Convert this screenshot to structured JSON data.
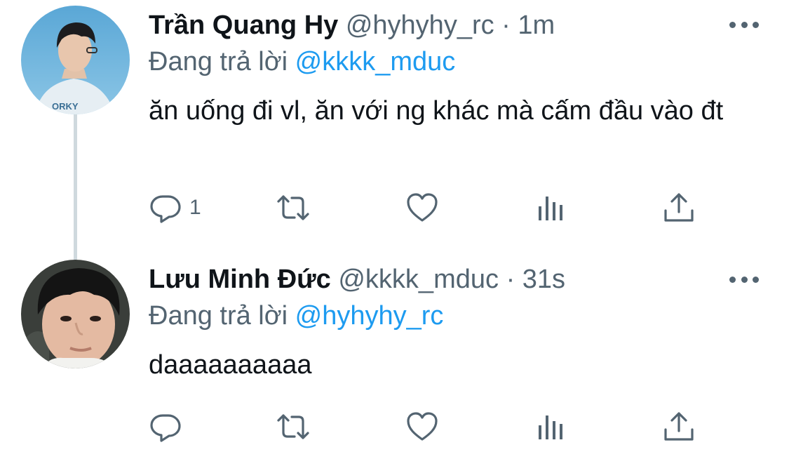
{
  "tweets": [
    {
      "name": "Trần Quang Hy",
      "handle": "@hyhyhy_rc",
      "dot": "·",
      "time": "1m",
      "reply_prefix": "Đang trả lời",
      "reply_to": "@kkkk_mduc",
      "text": "ăn uống đi vl, ăn với ng khác mà cấm đầu vào đt",
      "reply_count": "1",
      "avatar_shirt_text": "ORKY"
    },
    {
      "name": "Lưu Minh Đức",
      "handle": "@kkkk_mduc",
      "dot": "·",
      "time": "31s",
      "reply_prefix": "Đang trả lời",
      "reply_to": "@hyhyhy_rc",
      "text": "daaaaaaaaaa",
      "reply_count": ""
    }
  ],
  "icons": {
    "reply": "reply-icon",
    "retweet": "retweet-icon",
    "like": "heart-icon",
    "analytics": "analytics-icon",
    "share": "share-icon",
    "more": "more-icon"
  },
  "colors": {
    "text": "#0f1419",
    "secondary": "#536471",
    "mention": "#1d9bf0",
    "thread_line": "#cfd9de"
  }
}
